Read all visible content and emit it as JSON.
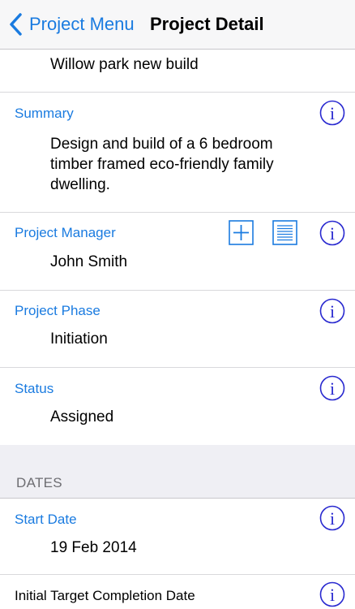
{
  "navbar": {
    "back_label": "Project Menu",
    "title": "Project Detail"
  },
  "project_name": "Willow park new build",
  "fields": {
    "summary": {
      "label": "Summary",
      "value_lines": [
        "Design and build of a 6 bedroom",
        "timber framed eco-friendly family",
        "dwelling."
      ]
    },
    "project_manager": {
      "label": "Project Manager",
      "value": "John Smith"
    },
    "project_phase": {
      "label": "Project Phase",
      "value": "Initiation"
    },
    "status": {
      "label": "Status",
      "value": "Assigned"
    }
  },
  "dates_section": {
    "title": "DATES",
    "start_date": {
      "label": "Start Date",
      "value": "19 Feb 2014"
    },
    "initial_target_completion": {
      "label": "Initial Target Completion Date"
    }
  },
  "icons": {
    "info": "info-circle-icon",
    "add": "plus-square-icon",
    "list": "list-square-icon",
    "back": "chevron-left-icon"
  },
  "colors": {
    "accent": "#1a7be0",
    "info_icon": "#2a2ad0",
    "nav_background": "#f7f7f8",
    "section_background": "#efeff4"
  }
}
